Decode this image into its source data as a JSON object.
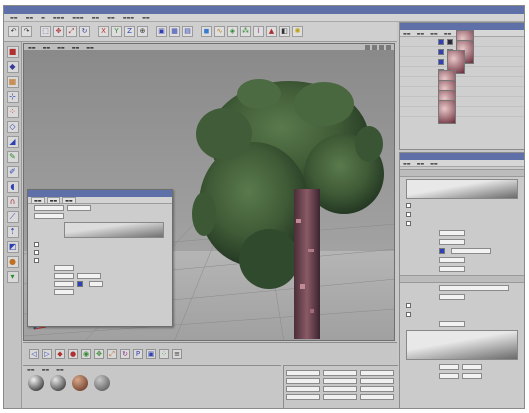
{
  "colors": {
    "window_title_bg": "#5f6fa8",
    "ui_gray": "#c8c8c8",
    "viewport_bg": "#8f8f8f",
    "foliage": "#3f5a36",
    "trunk": "#7a4e5a"
  },
  "toolbar_icons": [
    "undo-icon",
    "redo-icon",
    "live-select-icon",
    "move-icon",
    "scale-icon",
    "rotate-icon",
    "x-axis-icon",
    "y-axis-icon",
    "z-axis-icon",
    "coordinate-icon",
    "render-region-icon",
    "render-view-icon",
    "render-settings-icon",
    "cube-icon",
    "spline-icon",
    "nurbs-icon",
    "array-icon",
    "deformer-icon",
    "scene-icon",
    "camera-icon",
    "light-icon"
  ],
  "left_tool_icons": [
    "model-mode-icon",
    "object-mode-icon",
    "texture-mode-icon",
    "axis-mode-icon",
    "points-mode-icon",
    "edges-mode-icon",
    "polygons-mode-icon",
    "paint-icon",
    "brush-icon",
    "sculpt-icon",
    "magnet-icon",
    "knife-icon",
    "extrude-icon",
    "bevel-icon",
    "smooth-icon",
    "lock-icon"
  ],
  "object_rows": [
    {
      "tags": [
        "blue",
        "dark",
        "mat"
      ]
    },
    {
      "tags": [
        "blue",
        "dark",
        "mat"
      ]
    },
    {
      "tags": [
        "blue",
        "mat"
      ]
    },
    {
      "tags": [
        "blue"
      ]
    },
    {
      "tags": [
        "mat"
      ]
    },
    {
      "tags": [
        "mat"
      ]
    },
    {
      "tags": [
        "mat"
      ]
    },
    {
      "tags": [
        "mat"
      ]
    }
  ],
  "materials": [
    {
      "color_a": "#f2f2f2",
      "color_b": "#111111"
    },
    {
      "color_a": "#e6e6e6",
      "color_b": "#1e1e1e"
    },
    {
      "color_a": "#d9a88a",
      "color_b": "#5a2a18"
    },
    {
      "color_a": "#c8c8c8",
      "color_b": "#4a4a4a"
    }
  ],
  "timeline_icons": [
    "rewind-icon",
    "play-icon",
    "keyframe-icon",
    "record-icon",
    "autokey-icon",
    "move-key-icon",
    "scale-key-icon",
    "rotate-key-icon",
    "param-key-icon",
    "pla-key-icon",
    "point-key-icon",
    "timeline-settings-icon"
  ]
}
